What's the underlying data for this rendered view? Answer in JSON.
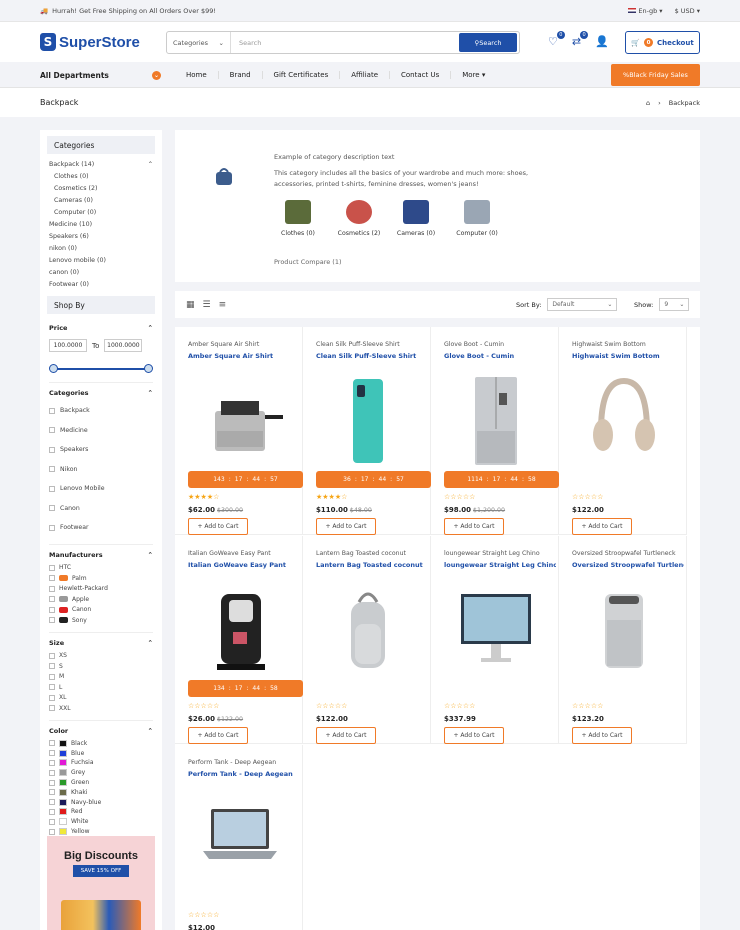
{
  "topbar": {
    "promo": "Hurrah! Get Free Shipping on All Orders Over $99!",
    "language": "En-gb",
    "currency": "$ USD"
  },
  "header": {
    "logo": "SuperStore",
    "search_category": "Categories",
    "search_placeholder": "Search",
    "search_button": "Search",
    "wishlist_count": "0",
    "compare_count": "0",
    "cart_count": "0",
    "checkout_label": "Checkout"
  },
  "nav": {
    "departments": "All Departments",
    "links": [
      "Home",
      "Brand",
      "Gift Certificates",
      "Affiliate",
      "Contact Us",
      "More"
    ],
    "promo_button": "Black Friday Sales"
  },
  "breadcrumb": {
    "title": "Backpack",
    "current": "Backpack"
  },
  "sidebar": {
    "categories_title": "Categories",
    "categories": [
      {
        "label": "Backpack (14)",
        "sub": false
      },
      {
        "label": "Clothes (0)",
        "sub": true
      },
      {
        "label": "Cosmetics (2)",
        "sub": true
      },
      {
        "label": "Cameras (0)",
        "sub": true
      },
      {
        "label": "Computer (0)",
        "sub": true
      },
      {
        "label": "Medicine (10)",
        "sub": false
      },
      {
        "label": "Speakers (6)",
        "sub": false
      },
      {
        "label": "nikon (0)",
        "sub": false
      },
      {
        "label": "Lenovo mobile (0)",
        "sub": false
      },
      {
        "label": "canon (0)",
        "sub": false
      },
      {
        "label": "Footwear (0)",
        "sub": false
      }
    ],
    "shopby_title": "Shop By",
    "price_title": "Price",
    "price_min": "100.0000",
    "price_to": "To",
    "price_max": "1000.0000",
    "filter_categories_title": "Categories",
    "filter_categories": [
      "Backpack",
      "Medicine",
      "Speakers",
      "Nikon",
      "Lenovo Mobile",
      "Canon",
      "Footwear"
    ],
    "manufacturers_title": "Manufacturers",
    "manufacturers": [
      "HTC",
      "Palm",
      "Hewlett-Packard",
      "Apple",
      "Canon",
      "Sony"
    ],
    "size_title": "Size",
    "sizes": [
      "XS",
      "S",
      "M",
      "L",
      "XL",
      "XXL"
    ],
    "color_title": "Color",
    "colors": [
      {
        "name": "Black",
        "hex": "#111111"
      },
      {
        "name": "Blue",
        "hex": "#1f3fd8"
      },
      {
        "name": "Fuchsia",
        "hex": "#e21ad6"
      },
      {
        "name": "Grey",
        "hex": "#999999"
      },
      {
        "name": "Green",
        "hex": "#2a9a2a"
      },
      {
        "name": "Khaki",
        "hex": "#6b6b4a"
      },
      {
        "name": "Navy-blue",
        "hex": "#1a1a5a"
      },
      {
        "name": "Red",
        "hex": "#e01a1a"
      },
      {
        "name": "White",
        "hex": "#ffffff"
      },
      {
        "name": "Yellow",
        "hex": "#f0e83a"
      }
    ],
    "banner_title": "Big Discounts",
    "banner_tag": "SAVE 15% OFF"
  },
  "category": {
    "example": "Example of category description text",
    "description": "This category includes all the basics of your wardrobe and much more: shoes, accessories, printed t-shirts, feminine dresses, women's jeans!",
    "subcats": [
      {
        "label": "Clothes (0)",
        "color": "#5b6b3a"
      },
      {
        "label": "Cosmetics (2)",
        "color": "#c9524a"
      },
      {
        "label": "Cameras (0)",
        "color": "#2e4a8a"
      },
      {
        "label": "Computer (0)",
        "color": "#9aa6b4"
      }
    ],
    "compare": "Product Compare (1)"
  },
  "toolbar": {
    "sort_label": "Sort By:",
    "sort_value": "Default",
    "show_label": "Show:",
    "show_value": "9"
  },
  "products": [
    {
      "small": "Amber Square Air Shirt",
      "name": "Amber Square Air Shirt",
      "price": "$62.00",
      "old": "$300.00",
      "timer": [
        "143",
        "17",
        "44",
        "57"
      ],
      "img": "fryer"
    },
    {
      "small": "Clean Silk Puff-Sleeve Shirt",
      "name": "Clean Silk Puff-Sleeve Shirt",
      "price": "$110.00",
      "old": "$48.00",
      "timer": [
        "36",
        "17",
        "44",
        "57"
      ],
      "img": "phone"
    },
    {
      "small": "Glove Boot - Cumin",
      "name": "Glove Boot - Cumin",
      "price": "$98.00",
      "old": "$1,200.00",
      "timer": [
        "1114",
        "17",
        "44",
        "58"
      ],
      "img": "fridge"
    },
    {
      "small": "Highwaist Swim Bottom",
      "name": "Highwaist Swim Bottom",
      "price": "$122.00",
      "old": "",
      "timer": null,
      "img": "headphones"
    },
    {
      "small": "Italian GoWeave Easy Pant",
      "name": "Italian GoWeave Easy Pant",
      "price": "$26.00",
      "old": "$122.00",
      "timer": [
        "134",
        "17",
        "44",
        "58"
      ],
      "img": "coffee"
    },
    {
      "small": "Lantern Bag Toasted coconut",
      "name": "Lantern Bag Toasted coconut",
      "price": "$122.00",
      "old": "",
      "timer": null,
      "img": "speaker"
    },
    {
      "small": "loungewear Straight Leg Chino",
      "name": "loungewear Straight Leg Chino",
      "price": "$337.99",
      "old": "",
      "timer": null,
      "img": "monitor"
    },
    {
      "small": "Oversized Stroopwafel Turtleneck",
      "name": "Oversized Stroopwafel Turtleneck",
      "price": "$123.20",
      "old": "",
      "timer": null,
      "img": "purifier"
    },
    {
      "small": "Perform Tank - Deep Aegean",
      "name": "Perform Tank - Deep Aegean",
      "price": "$12.00",
      "old": "",
      "timer": null,
      "img": "laptop"
    }
  ],
  "add_to_cart": "+ Add to Cart",
  "colors": {
    "brand": "#1f4fa8",
    "accent": "#f07a28"
  }
}
